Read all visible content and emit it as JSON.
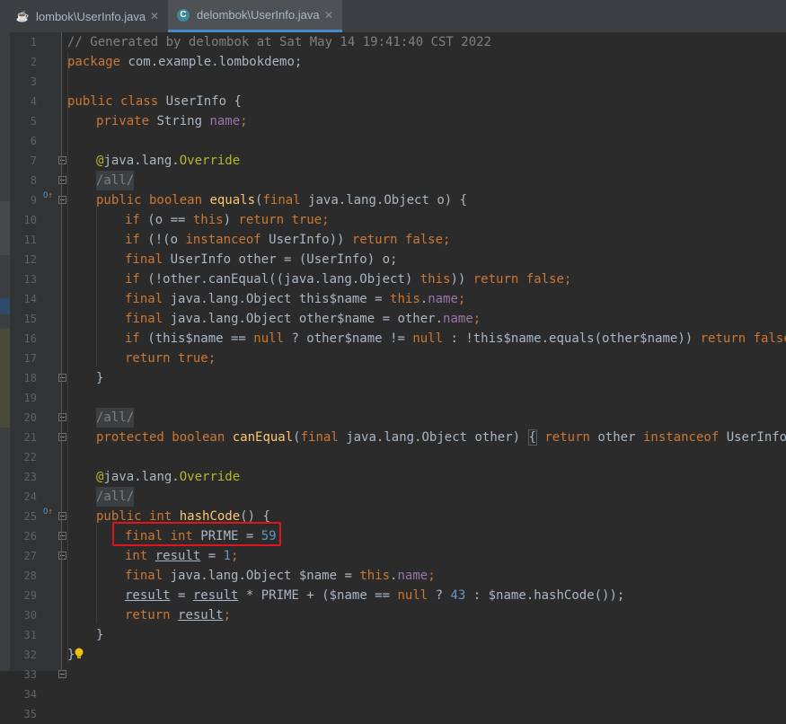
{
  "tabs": [
    {
      "label": "lombok\\UserInfo.java",
      "icon": "java-file-icon",
      "active": false
    },
    {
      "label": "delombok\\UserInfo.java",
      "icon": "class-file-icon",
      "active": true
    }
  ],
  "close_glyph": "✕",
  "line_numbers": [
    "1",
    "2",
    "3",
    "4",
    "5",
    "6",
    "7",
    "8",
    "9",
    "10",
    "11",
    "12",
    "13",
    "14",
    "15",
    "16",
    "17",
    "18",
    "19",
    "20",
    "21",
    "22",
    "23",
    "24",
    "25",
    "26",
    "27",
    "28",
    "29",
    "30",
    "31",
    "32",
    "33",
    "34",
    "35"
  ],
  "gutter_marks": {
    "overriding_glyph": "O",
    "arrow_glyph": "↑"
  },
  "code": {
    "l1": "// Generated by delombok at Sat May 14 19:41:40 CST 2022",
    "l2_kw": "package",
    "l2": " com.example.lombokdemo;",
    "l4_kw": "public class",
    "l4": " UserInfo {",
    "l5_kw": "private",
    "l5_t": " String ",
    "l5_f": "name",
    "l5_e": ";",
    "l7_a": "@",
    "l7_p": "java.lang.",
    "l7_o": "Override",
    "l8": "/all/",
    "l9_kw": "public boolean",
    "l9_fn": "equals",
    "l9_p": "(",
    "l9_kw2": "final",
    "l9_r": " java.lang.Object o) {",
    "l10_if": "if",
    "l10_a": " (o == ",
    "l10_this": "this",
    "l10_b": ") ",
    "l10_ret": "return true",
    "l10_e": ";",
    "l11_if": "if",
    "l11_a": " (!(o ",
    "l11_inst": "instanceof",
    "l11_b": " UserInfo)) ",
    "l11_ret": "return false",
    "l11_e": ";",
    "l12_f": "final",
    "l12": " UserInfo other = (UserInfo) o;",
    "l13_if": "if",
    "l13_a": " (!other.canEqual((java.lang.Object) ",
    "l13_this": "this",
    "l13_b": ")) ",
    "l13_ret": "return false",
    "l13_e": ";",
    "l14_f": "final",
    "l14_a": " java.lang.Object this$name = ",
    "l14_this": "this",
    "l14_d": ".",
    "l14_n": "name",
    "l14_e": ";",
    "l15_f": "final",
    "l15_a": " java.lang.Object other$name = other.",
    "l15_n": "name",
    "l15_e": ";",
    "l16_if": "if",
    "l16_a": " (this$name == ",
    "l16_null": "null",
    "l16_b": " ? other$name != ",
    "l16_null2": "null",
    "l16_c": " : !this$name.equals(other$name)) ",
    "l16_ret": "return false",
    "l16_e": ";",
    "l17_ret": "return true",
    "l17_e": ";",
    "l18": "}",
    "l20": "/all/",
    "l21_kw": "protected boolean",
    "l21_fn": "canEqual",
    "l21_p": "(",
    "l21_f": "final",
    "l21_a": " java.lang.Object other)",
    "l21_ob": "{",
    "l21_ret": "return",
    "l21_b": " other ",
    "l21_inst": "instanceof",
    "l21_c": " UserInfo",
    "l21_e": ";",
    "l21_cb": "}",
    "l25_a": "@",
    "l25_p": "java.lang.",
    "l25_o": "Override",
    "l26": "/all/",
    "l27_kw": "public int",
    "l27_fn": "hashCode",
    "l27_r": "() {",
    "l28_kw": "final int",
    "l28_a": " PRIME = ",
    "l28_n": "59",
    "l28_e": ";",
    "l29_kw": "int",
    "l29_v": "result",
    "l29_a": " = ",
    "l29_n": "1",
    "l29_e": ";",
    "l30_f": "final",
    "l30_a": " java.lang.Object $name = ",
    "l30_this": "this",
    "l30_d": ".",
    "l30_n": "name",
    "l30_e": ";",
    "l31_v": "result",
    "l31_a": " = ",
    "l31_v2": "result",
    "l31_b": " * PRIME + ($name == ",
    "l31_null": "null",
    "l31_c": " ? ",
    "l31_n": "43",
    "l31_d": " : $name.hashCode());",
    "l32_ret": "return",
    "l32_sp": " ",
    "l32_v": "result",
    "l32_e": ";",
    "l33": "}",
    "l34": "}"
  }
}
